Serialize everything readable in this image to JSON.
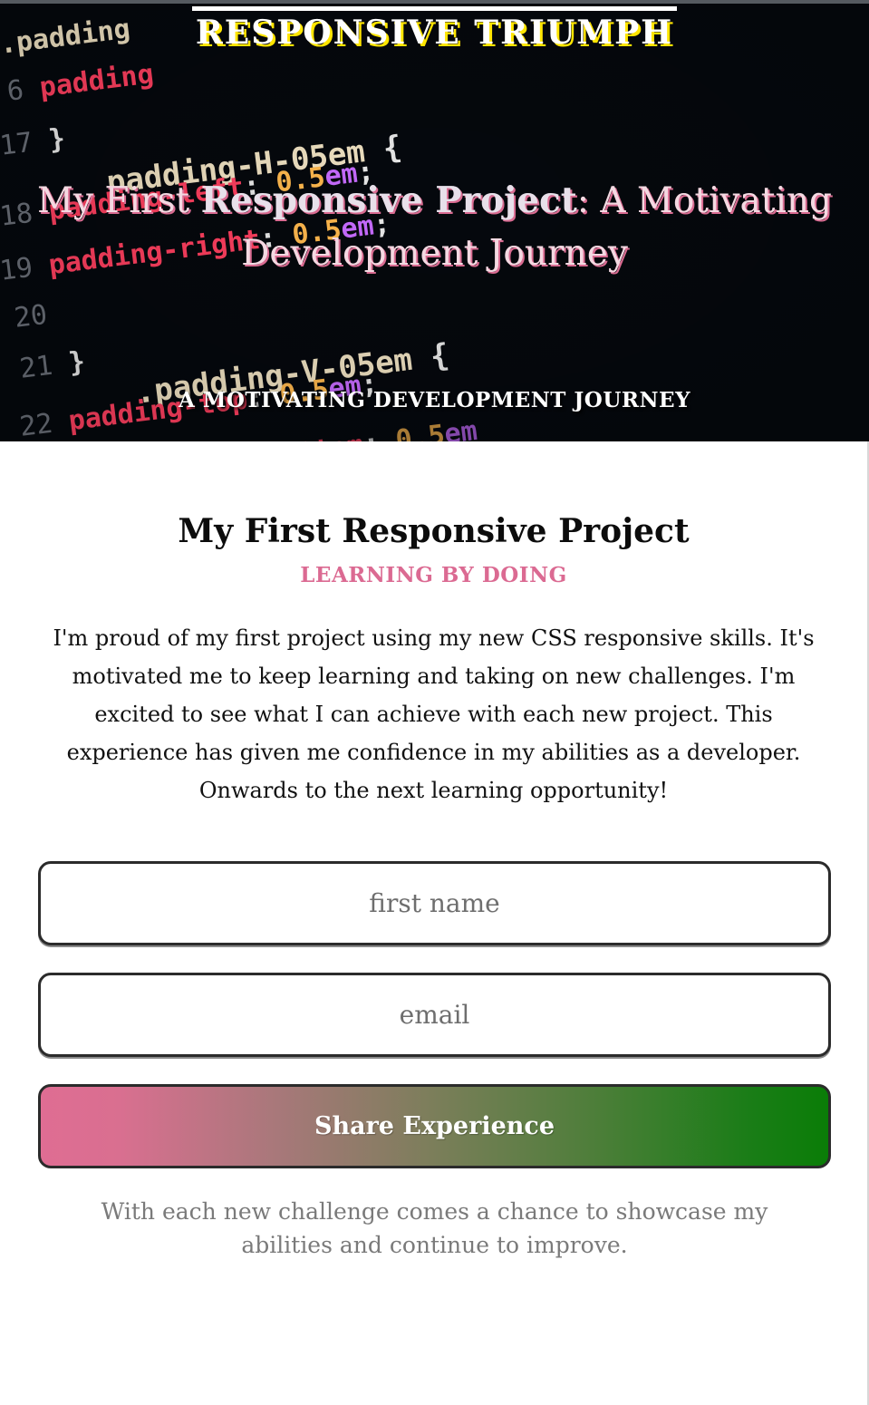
{
  "hero": {
    "brand": "RESPONSIVE TRIUMPH",
    "title_pre": "My First ",
    "title_emphasis": "Responsive Project",
    "title_post": ": A Motivating Development Journey",
    "tagline": "A MOTIVATING DEVELOPMENT JOURNEY",
    "background_image": "css-code-screenshot"
  },
  "content": {
    "title": "My First Responsive Project",
    "subtitle": "LEARNING BY DOING",
    "body": "I'm proud of my first project using my new CSS responsive skills. It's motivated me to keep learning and taking on new challenges. I'm excited to see what I can achieve with each new project. This experience has given me confidence in my abilities as a developer. Onwards to the next learning opportunity!"
  },
  "form": {
    "first_name_placeholder": "first name",
    "first_name_value": "",
    "email_placeholder": "email",
    "email_value": "",
    "submit_label": "Share Experience"
  },
  "closing": "With each new challenge comes a chance to showcase my abilities and continue to improve.",
  "colors": {
    "accent_pink": "#db6a92",
    "accent_green": "#0a7d07",
    "brand_shadow_yellow": "#ffe500"
  }
}
